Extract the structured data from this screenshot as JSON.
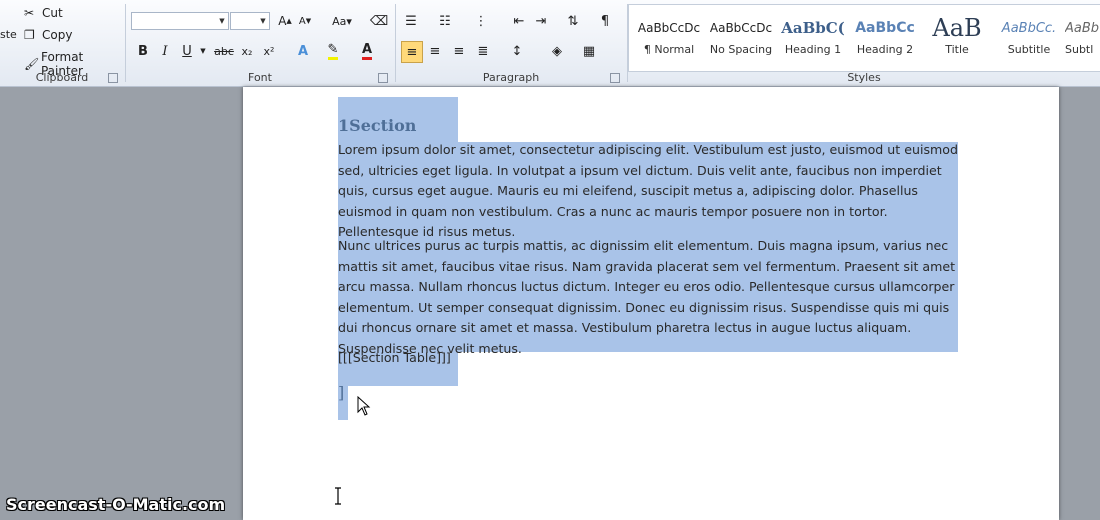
{
  "clipboard": {
    "group": "Clipboard",
    "cut": "Cut",
    "copy": "Copy",
    "format_painter": "Format Painter",
    "paste_partial": "ste"
  },
  "font": {
    "group": "Font",
    "family_value": "",
    "size_value": "",
    "bold": "B",
    "italic": "I",
    "underline": "U",
    "strike": "abc",
    "sub": "x₂",
    "sup": "x²"
  },
  "paragraph": {
    "group": "Paragraph"
  },
  "styles": {
    "group": "Styles",
    "items": [
      {
        "preview": "AaBbCcDc",
        "name": "¶ Normal"
      },
      {
        "preview": "AaBbCcDc",
        "name": "No Spacing"
      },
      {
        "preview": "AaBbC(",
        "name": "Heading 1"
      },
      {
        "preview": "AaBbCc",
        "name": "Heading 2"
      },
      {
        "preview": "AaB",
        "name": "Title"
      },
      {
        "preview": "AaBbCc.",
        "name": "Subtitle"
      },
      {
        "preview": "AaBb",
        "name": "Subtl"
      }
    ]
  },
  "document": {
    "heading": "1Section",
    "para1": "Lorem ipsum dolor sit amet, consectetur adipiscing elit. Vestibulum est justo, euismod ut euismod sed, ultricies eget ligula.  In volutpat a ipsum vel dictum. Duis velit ante, faucibus non imperdiet quis, cursus eget augue. Mauris eu mi eleifend, suscipit metus a, adipiscing dolor. Phasellus euismod in quam non vestibulum. Cras a nunc ac mauris tempor posuere non in tortor. Pellentesque id risus metus.",
    "para2": "Nunc ultrices purus ac turpis mattis, ac dignissim elit  elementum. Duis magna ipsum, varius nec mattis sit amet, faucibus vitae risus. Nam gravida placerat sem vel fermentum. Praesent sit amet arcu massa. Nullam rhoncus luctus dictum. Integer eu eros odio. Pellentesque cursus ullamcorper elementum. Ut semper consequat dignissim. Donec eu dignissim risus. Suspendisse quis mi quis dui rhoncus ornare sit amet et massa. Vestibulum pharetra lectus in augue luctus aliquam. Suspendisse nec velit metus.",
    "placeholder": "[[[Section Table]]]",
    "bracket": "]"
  },
  "watermark": "Screencast-O-Matic.com",
  "colors": {
    "selection": "#a9c3e8",
    "heading": "#4f6f97",
    "ribbon_bg": "#e3e9f2",
    "active_align": "#ffd97a"
  }
}
